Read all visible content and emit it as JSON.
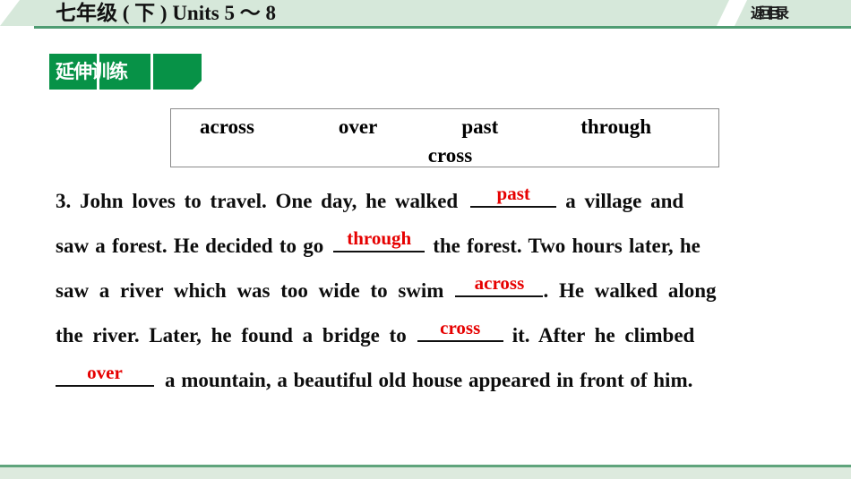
{
  "header": {
    "title": "七年级 ( 下 ) Units 5 ～ 8",
    "return_label": "返回目录"
  },
  "section": {
    "badge_label": "延伸训练"
  },
  "word_bank": {
    "row1": [
      "across",
      "over",
      "past",
      "through"
    ],
    "row2": [
      "cross"
    ]
  },
  "passage": {
    "number": "3.",
    "lines": [
      {
        "before": "3. John loves to travel. One day, he walked",
        "blank": "past",
        "after": "a village and"
      },
      {
        "before": "saw a forest. He decided to go",
        "blank": "through",
        "after": "the forest. Two hours later, he"
      },
      {
        "before": "saw a river which was too wide to swim",
        "blank": "across",
        "after": ". He walked along"
      },
      {
        "before": "the river. Later, he found a bridge to",
        "blank": "cross",
        "after": "it. After he climbed"
      },
      {
        "before": "",
        "blank": "over",
        "after": "a mountain, a beautiful old house appeared in front of him."
      }
    ]
  },
  "colors": {
    "header_band": "#d6e8da",
    "header_rule": "#4f9c72",
    "badge_green": "#079247",
    "answer_red": "#e60000",
    "footer_band": "#ddeade"
  }
}
